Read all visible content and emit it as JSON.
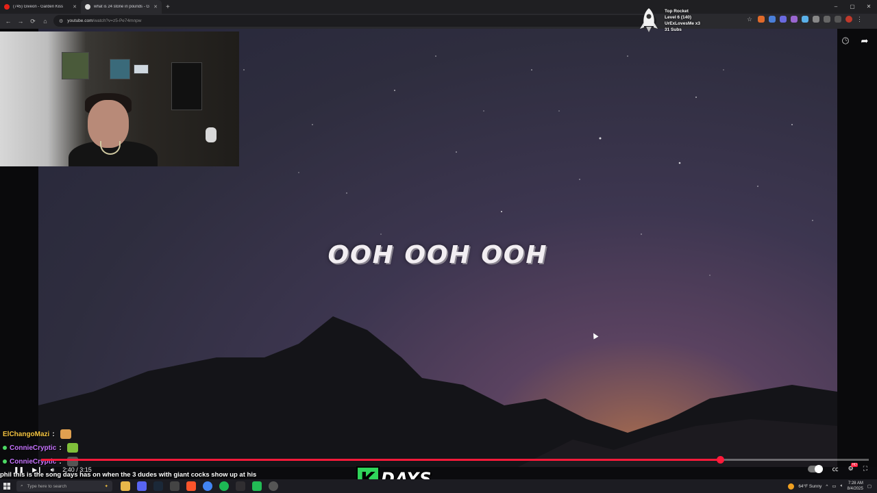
{
  "browser": {
    "tabs": [
      {
        "label": "(745) Giveon - Garden Kiss",
        "favicon_color": "#e62117",
        "active": false
      },
      {
        "label": "what is 24 stone in pounds - G",
        "favicon_color": "#dddddd",
        "active": true
      }
    ],
    "new_tab": "+",
    "address": {
      "host": "youtube.com",
      "path": "/watch?v=z5-Pe74mnpw"
    },
    "window_controls": [
      "–",
      "▢",
      "✕"
    ]
  },
  "rocket": {
    "title": "Top Rocket",
    "level": "Level 6 (140)",
    "user": "UrExLovesMe x3",
    "subs": "31 Subs"
  },
  "video": {
    "lyric": "OOH OOH OOH"
  },
  "player": {
    "current_time": "2:40",
    "separator": " / ",
    "duration": "3:15",
    "progress_fraction": 0.82
  },
  "chat": [
    {
      "user": "ElChangoMazi",
      "suffix": " :",
      "color": "#f5c542",
      "has_dot": false,
      "emote_color": "#e0a050"
    },
    {
      "user": "ConnieCryptic",
      "suffix": " :",
      "color": "#c774ff",
      "has_dot": true,
      "emote_color": "#7fbf3a"
    },
    {
      "user": "ConnieCryptic",
      "suffix": " :",
      "color": "#c774ff",
      "has_dot": true,
      "emote_color": "#555555"
    }
  ],
  "subtitle": "phil this is the song days has on when the 3 dudes with giant cocks show up at his",
  "overlay_logo": {
    "k": "K",
    "days": "DAYS"
  },
  "taskbar": {
    "search_placeholder": "Type here to search",
    "weather": "64°F  Sunny",
    "time": "7:28 AM",
    "date": "8/4/2025"
  },
  "colors": {
    "accent": "#ff1a3a",
    "chat_green": "#4cd964"
  }
}
